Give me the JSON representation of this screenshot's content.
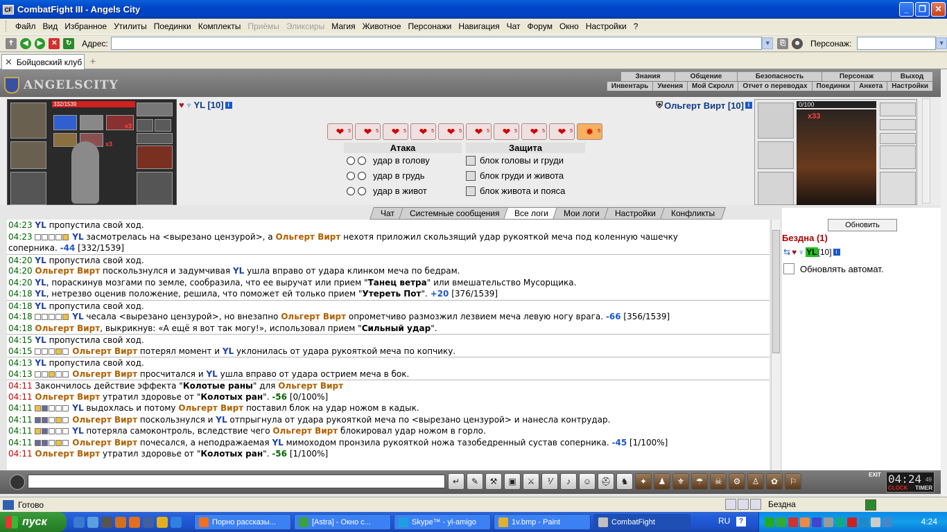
{
  "window": {
    "title": "CombatFight III - Angels City",
    "app_icon": "CF"
  },
  "menu": [
    "Файл",
    "Вид",
    "Избранное",
    "Утилиты",
    "Поединки",
    "Комплекты",
    "Приёмы",
    "Эликсиры",
    "Магия",
    "Животное",
    "Персонажи",
    "Навигация",
    "Чат",
    "Форум",
    "Окно",
    "Настройки",
    "?"
  ],
  "menu_disabled": [
    "Приёмы",
    "Эликсиры"
  ],
  "addressbar": {
    "label": "Адрес:",
    "value": "",
    "char_label": "Персонаж:",
    "char_value": ""
  },
  "tab": {
    "label": "Бойцовский клуб"
  },
  "game": {
    "logo": "ANGELSCITY",
    "nav_top": [
      "Знания",
      "Общение",
      "Безопасность",
      "Персонаж",
      "Выход"
    ],
    "nav_sub": [
      "Инвентарь",
      "Умения",
      "Мой Скролл",
      "Отчет о переводах",
      "Поединки",
      "Анкета",
      "Настройки"
    ],
    "player_left": {
      "name": "YL [10]",
      "hp": "332/1539",
      "x_counts": [
        "x3",
        "x3"
      ]
    },
    "player_right": {
      "name": "Ольгерт Вирт [10]",
      "hp": "0/100",
      "x_count": "x33"
    },
    "action_badge": "5",
    "attack_header": "Атака",
    "defense_header": "Защита",
    "attack_options": [
      "удар в голову",
      "удар в грудь",
      "удар в живот"
    ],
    "defense_options": [
      "блок головы и груди",
      "блок груди и живота",
      "блок живота и пояса"
    ],
    "log_tabs": [
      "Чат",
      "Системные сообщения",
      "Все логи",
      "Мои логи",
      "Настройки",
      "Конфликты"
    ],
    "active_log_tab": "Все логи"
  },
  "log": [
    {
      "t": "04:23",
      "sep": false,
      "html": "<span class=\"yl\">YL</span> пропустила свой ход."
    },
    {
      "t": "04:23",
      "sep": false,
      "html": "<span class=\"bx\"></span><span class=\"bx\"></span><span class=\"bx\"></span><span class=\"bx\"></span><span class=\"bx o\"></span> <span class=\"yl\">YL</span> засмотрелась на &lt;вырезано цензурой&gt;, а <span class=\"olg\">Ольгерт Вирт</span> нехотя приложил скользящий удар рукояткой меча под коленную чашечку"
    },
    {
      "t": "",
      "sep": false,
      "html": "соперника. <span class=\"num\">-44</span> [332/1539]"
    },
    {
      "t": "04:20",
      "sep": true,
      "html": "<span class=\"yl\">YL</span> пропустила свой ход."
    },
    {
      "t": "04:20",
      "sep": false,
      "html": "<span class=\"olg\">Ольгерт Вирт</span> поскользнулся и задумчивая <span class=\"yl\">YL</span> ушла вправо от удара клинком меча по бедрам."
    },
    {
      "t": "04:20",
      "sep": false,
      "html": "<span class=\"yl\">YL</span>, пораскинув мозгами по земле, сообразила, что ее выручат или прием \"<b>Танец ветра</b>\" или вмешательство Мусорщика."
    },
    {
      "t": "04:18",
      "sep": false,
      "html": "<span class=\"yl\">YL</span>, нетрезво оценив положение, решила, что поможет ей только прием \"<b>Утереть Пот</b>\". <span class=\"num\">+20</span> [376/1539]"
    },
    {
      "t": "04:18",
      "sep": true,
      "html": "<span class=\"yl\">YL</span> пропустила свой ход."
    },
    {
      "t": "04:18",
      "sep": false,
      "html": "<span class=\"bx\"></span><span class=\"bx\"></span><span class=\"bx\"></span><span class=\"bx\"></span><span class=\"bx o\"></span> <span class=\"yl\">YL</span> чесала &lt;вырезано цензурой&gt;, но внезапно <span class=\"olg\">Ольгерт Вирт</span> опрометчиво размозжил лезвием меча левую ногу врага. <span class=\"num\">-66</span> [356/1539]"
    },
    {
      "t": "04:18",
      "sep": false,
      "html": "<span class=\"olg\">Ольгерт Вирт</span>, выкрикнув: «А ещё я вот так могу!», использовал прием \"<b>Сильный удар</b>\"."
    },
    {
      "t": "04:15",
      "sep": true,
      "html": "<span class=\"yl\">YL</span> пропустила свой ход."
    },
    {
      "t": "04:15",
      "sep": false,
      "html": "<span class=\"bx\"></span><span class=\"bx\"></span><span class=\"bx\"></span><span class=\"bx o\"></span><span class=\"bx\"></span> <span class=\"olg\">Ольгерт Вирт</span> потерял момент и <span class=\"yl\">YL</span> уклонилась от удара рукояткой меча по копчику."
    },
    {
      "t": "04:13",
      "sep": true,
      "html": "<span class=\"yl\">YL</span> пропустила свой ход."
    },
    {
      "t": "04:13",
      "sep": false,
      "html": "<span class=\"bx\"></span><span class=\"bx\"></span><span class=\"bx o\"></span><span class=\"bx\"></span><span class=\"bx\"></span> <span class=\"olg\">Ольгерт Вирт</span> просчитался и <span class=\"yl\">YL</span> ушла вправо от удара острием меча в бок."
    },
    {
      "t": "04:11",
      "red": true,
      "sep": true,
      "html": "Закончилось действие эффекта \"<b>Колотые раны</b>\" для <span class=\"olg\">Ольгерт Вирт</span>"
    },
    {
      "t": "04:11",
      "red": true,
      "sep": false,
      "html": "<span class=\"olg\">Ольгерт Вирт</span> утратил здоровье от \"<b>Колотых ран</b>\". <span class=\"numg\">-56</span> [0/100%]"
    },
    {
      "t": "04:11",
      "sep": false,
      "html": "<span class=\"bx o\"></span><span class=\"bx f\"></span><span class=\"bx\"></span><span class=\"bx\"></span><span class=\"bx\"></span> <span class=\"yl\">YL</span> выдохлась и потому <span class=\"olg\">Ольгерт Вирт</span> поставил блок на удар ножом в кадык."
    },
    {
      "t": "04:11",
      "sep": false,
      "html": "<span class=\"bx f\"></span><span class=\"bx f\"></span><span class=\"bx\"></span><span class=\"bx o\"></span><span class=\"bx\"></span> <span class=\"olg\">Ольгерт Вирт</span> поскользнулся и <span class=\"yl\">YL</span> отпрыгнула от удара рукояткой меча по &lt;вырезано цензурой&gt; и нанесла контрудар."
    },
    {
      "t": "04:11",
      "sep": false,
      "html": "<span class=\"bx o\"></span><span class=\"bx f\"></span><span class=\"bx\"></span><span class=\"bx\"></span><span class=\"bx\"></span> <span class=\"yl\">YL</span> потеряла самоконтроль, вследствие чего <span class=\"olg\">Ольгерт Вирт</span> блокировал удар ножом в горло."
    },
    {
      "t": "04:11",
      "sep": false,
      "html": "<span class=\"bx f\"></span><span class=\"bx f\"></span><span class=\"bx\"></span><span class=\"bx o\"></span><span class=\"bx\"></span> <span class=\"olg\">Ольгерт Вирт</span> почесался, а неподражаемая <span class=\"yl\">YL</span> мимоходом пронзила рукояткой ножа тазобедренный сустав соперника. <span class=\"num\">-45</span> [1/100%]"
    },
    {
      "t": "04:11",
      "red": true,
      "sep": false,
      "html": "<span class=\"olg\">Ольгерт Вирт</span> утратил здоровье от \"<b>Колотых ран</b>\". <span class=\"numg\">-56</span> [1/100%]"
    }
  ],
  "side": {
    "refresh": "Обновить",
    "room": "Бездна (1)",
    "player": "YL",
    "level": "[10]",
    "auto": "Обновлять автомат."
  },
  "clock": {
    "time": "04:24",
    "seconds": "49",
    "label1": "CLOCK",
    "label2": "TIMER",
    "exit": "EXIT"
  },
  "status": {
    "text": "Готово",
    "room": "Бездна"
  },
  "taskbar": {
    "start": "пуск",
    "buttons": [
      {
        "label": "Порно рассказы...",
        "color": "#f07020"
      },
      {
        "label": "[Astra] - Окно с...",
        "color": "#3aa040"
      },
      {
        "label": "Skype™ - yl-amigo",
        "color": "#1ea0e0"
      },
      {
        "label": "1v.bmp - Paint",
        "color": "#e0b030"
      },
      {
        "label": "CombatFight",
        "color": "#c0c0c0",
        "active": true
      }
    ],
    "lang": "RU",
    "time": "4:24"
  }
}
